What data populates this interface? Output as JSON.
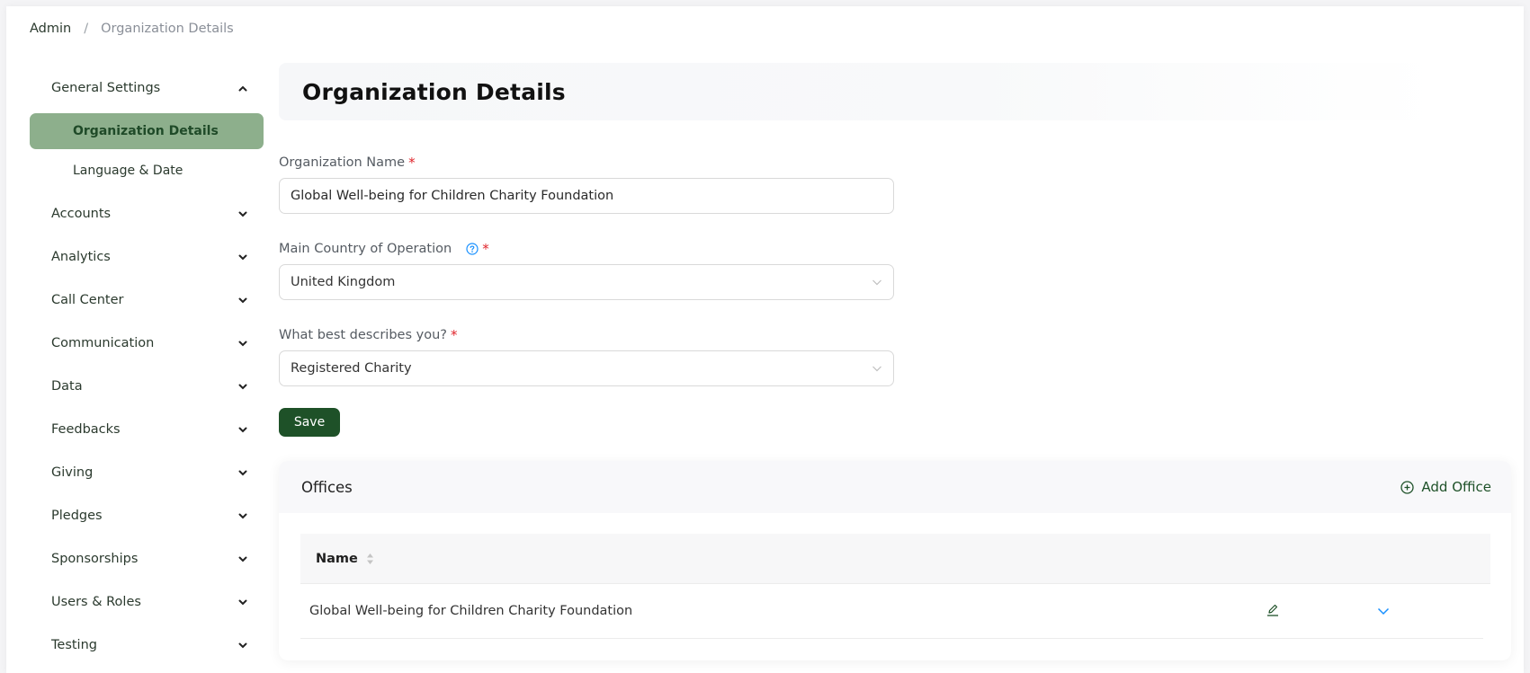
{
  "breadcrumb": {
    "root": "Admin",
    "separator": "/",
    "current": "Organization Details"
  },
  "sidebar": {
    "groups": [
      {
        "label": "General Settings",
        "expanded": true,
        "icon": "chevron-up-icon",
        "children": [
          {
            "label": "Organization Details",
            "active": true
          },
          {
            "label": "Language & Date",
            "active": false
          }
        ]
      },
      {
        "label": "Accounts",
        "expanded": false,
        "icon": "chevron-down-icon"
      },
      {
        "label": "Analytics",
        "expanded": false,
        "icon": "chevron-down-icon"
      },
      {
        "label": "Call Center",
        "expanded": false,
        "icon": "chevron-down-icon"
      },
      {
        "label": "Communication",
        "expanded": false,
        "icon": "chevron-down-icon"
      },
      {
        "label": "Data",
        "expanded": false,
        "icon": "chevron-down-icon"
      },
      {
        "label": "Feedbacks",
        "expanded": false,
        "icon": "chevron-down-icon"
      },
      {
        "label": "Giving",
        "expanded": false,
        "icon": "chevron-down-icon"
      },
      {
        "label": "Pledges",
        "expanded": false,
        "icon": "chevron-down-icon"
      },
      {
        "label": "Sponsorships",
        "expanded": false,
        "icon": "chevron-down-icon"
      },
      {
        "label": "Users & Roles",
        "expanded": false,
        "icon": "chevron-down-icon"
      },
      {
        "label": "Testing",
        "expanded": false,
        "icon": "chevron-down-icon"
      }
    ]
  },
  "main": {
    "title": "Organization Details",
    "form": {
      "org_name": {
        "label": "Organization Name",
        "required_mark": "*",
        "value": "Global Well-being for Children Charity Foundation"
      },
      "country": {
        "label": "Main Country of Operation",
        "required_mark": "*",
        "help_icon": "question-circle-icon",
        "value": "United Kingdom"
      },
      "describes": {
        "label": "What best describes you?",
        "required_mark": "*",
        "value": "Registered Charity"
      },
      "save_label": "Save"
    },
    "offices": {
      "title": "Offices",
      "add_label": "Add Office",
      "columns": [
        {
          "label": "Name",
          "sortable": true
        }
      ],
      "rows": [
        {
          "name": "Global Well-being for Children Charity Foundation"
        }
      ]
    }
  },
  "colors": {
    "brand_dark_green": "#1e5128",
    "active_nav_bg": "#8daf8c",
    "required": "#e0242b",
    "help_blue": "#1890ff",
    "expand_blue": "#1890ff"
  }
}
